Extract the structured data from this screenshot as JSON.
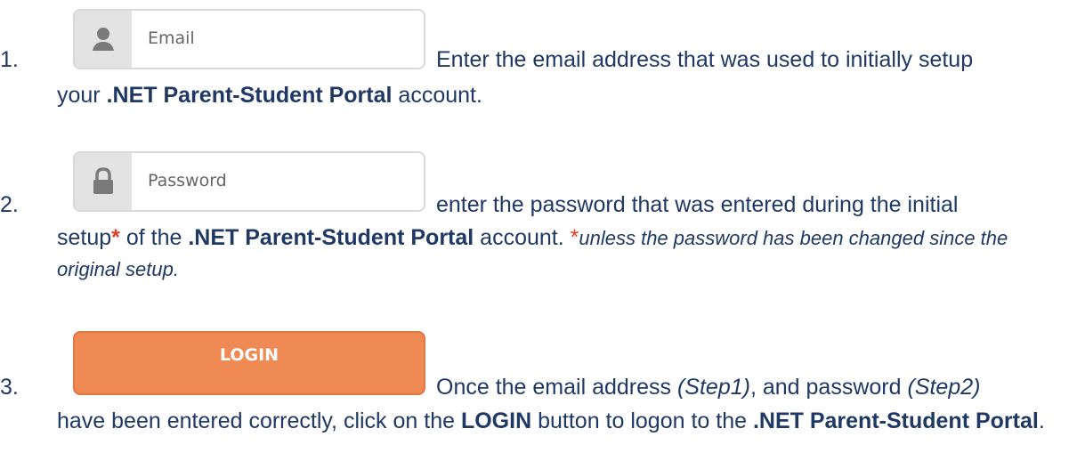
{
  "step1": {
    "number": "1.",
    "field_placeholder": "Email",
    "icon": "user-icon",
    "text_a": "Enter the email address that was used to initially setup",
    "text_b": "your ",
    "text_bold": ".NET Parent-Student Portal",
    "text_c": " account."
  },
  "step2": {
    "number": "2.",
    "field_placeholder": "Password",
    "icon": "lock-icon",
    "text_a": "enter the password that was entered during the initial",
    "text_b": "setup",
    "star": "*",
    "text_c": " of the ",
    "text_bold": ".NET Parent-Student Portal",
    "text_d": " account. ",
    "note_star": "*",
    "note": "unless the password has been changed since the original setup."
  },
  "step3": {
    "number": "3.",
    "button_label": "LOGIN",
    "text_a": "Once the email address ",
    "step1_ref": "(Step1)",
    "text_b": ", and password ",
    "step2_ref": "(Step2)",
    "text_c": "have been entered correctly, click on the ",
    "login_bold": "LOGIN",
    "text_d": " button to logon to the ",
    "portal_bold": ".NET Parent-Student Portal",
    "text_e": "."
  },
  "colors": {
    "text": "#1f3864",
    "accent_red": "#e0402a",
    "login_orange": "#f08a55"
  }
}
